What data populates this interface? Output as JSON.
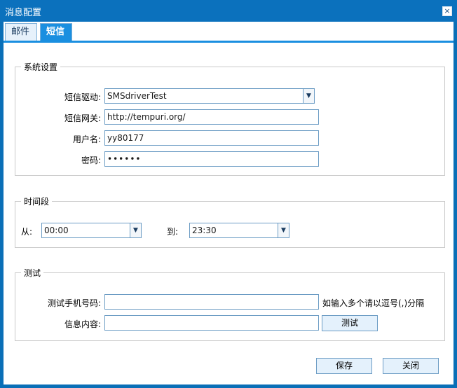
{
  "window": {
    "title": "消息配置",
    "close_label": "×"
  },
  "tabs": [
    {
      "label": "邮件",
      "selected": false
    },
    {
      "label": "短信",
      "selected": true
    }
  ],
  "system": {
    "legend": "系统设置",
    "driver_label": "短信驱动:",
    "driver_value": "SMSdriverTest",
    "gateway_label": "短信网关:",
    "gateway_value": "http://tempuri.org/",
    "username_label": "用户名:",
    "username_value": "yy80177",
    "password_label": "密码:",
    "password_value": "••••••"
  },
  "timeslot": {
    "legend": "时间段",
    "from_label": "从:",
    "from_value": "00:00",
    "to_label": "到:",
    "to_value": "23:30"
  },
  "test": {
    "legend": "测试",
    "phone_label": "测试手机号码:",
    "phone_value": "",
    "phone_hint": "如输入多个请以逗号(,)分隔",
    "content_label": "信息内容:",
    "content_value": "",
    "test_button": "测试"
  },
  "footer": {
    "save_button": "保存",
    "close_button": "关闭"
  },
  "colors": {
    "titlebar": "#0b71bd",
    "active_tab": "#1a8fe0",
    "button_bg": "#e4f1fc",
    "field_border": "#6c9cc4"
  }
}
